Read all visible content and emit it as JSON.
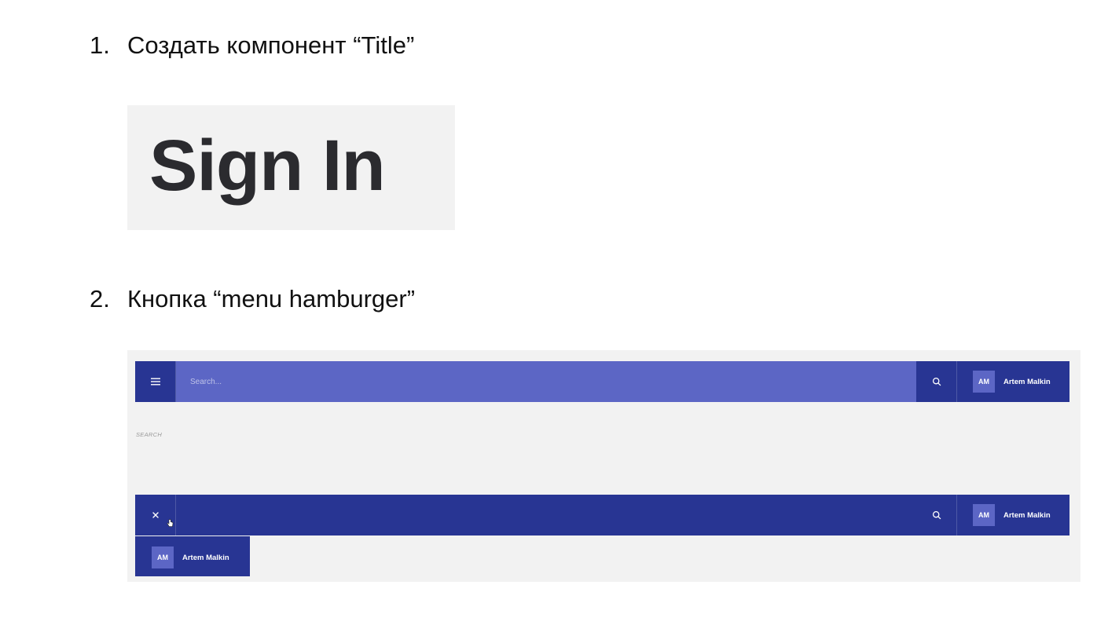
{
  "headings": [
    {
      "number": "1.",
      "text": "Создать компонент “Title”"
    },
    {
      "number": "2.",
      "text": "Кнопка “menu hamburger”"
    }
  ],
  "title_demo": {
    "text": "Sign In"
  },
  "navbar_closed": {
    "menu_icon": "hamburger-icon",
    "search_placeholder": "Search...",
    "clear_icon": "close-icon",
    "search_icon": "search-icon",
    "user": {
      "initials": "AM",
      "name": "Artem Malkin"
    }
  },
  "section_label": "SEARCH",
  "navbar_open": {
    "menu_icon": "close-icon",
    "search_icon": "search-icon",
    "user": {
      "initials": "AM",
      "name": "Artem Malkin"
    }
  },
  "dropdown": {
    "user": {
      "initials": "AM",
      "name": "Artem Malkin"
    }
  },
  "colors": {
    "navbar": "#283593",
    "search_bar": "#5c66c5",
    "avatar": "#5c66c5",
    "panel_bg": "#f2f2f2",
    "title_text": "#2b2b2f"
  }
}
